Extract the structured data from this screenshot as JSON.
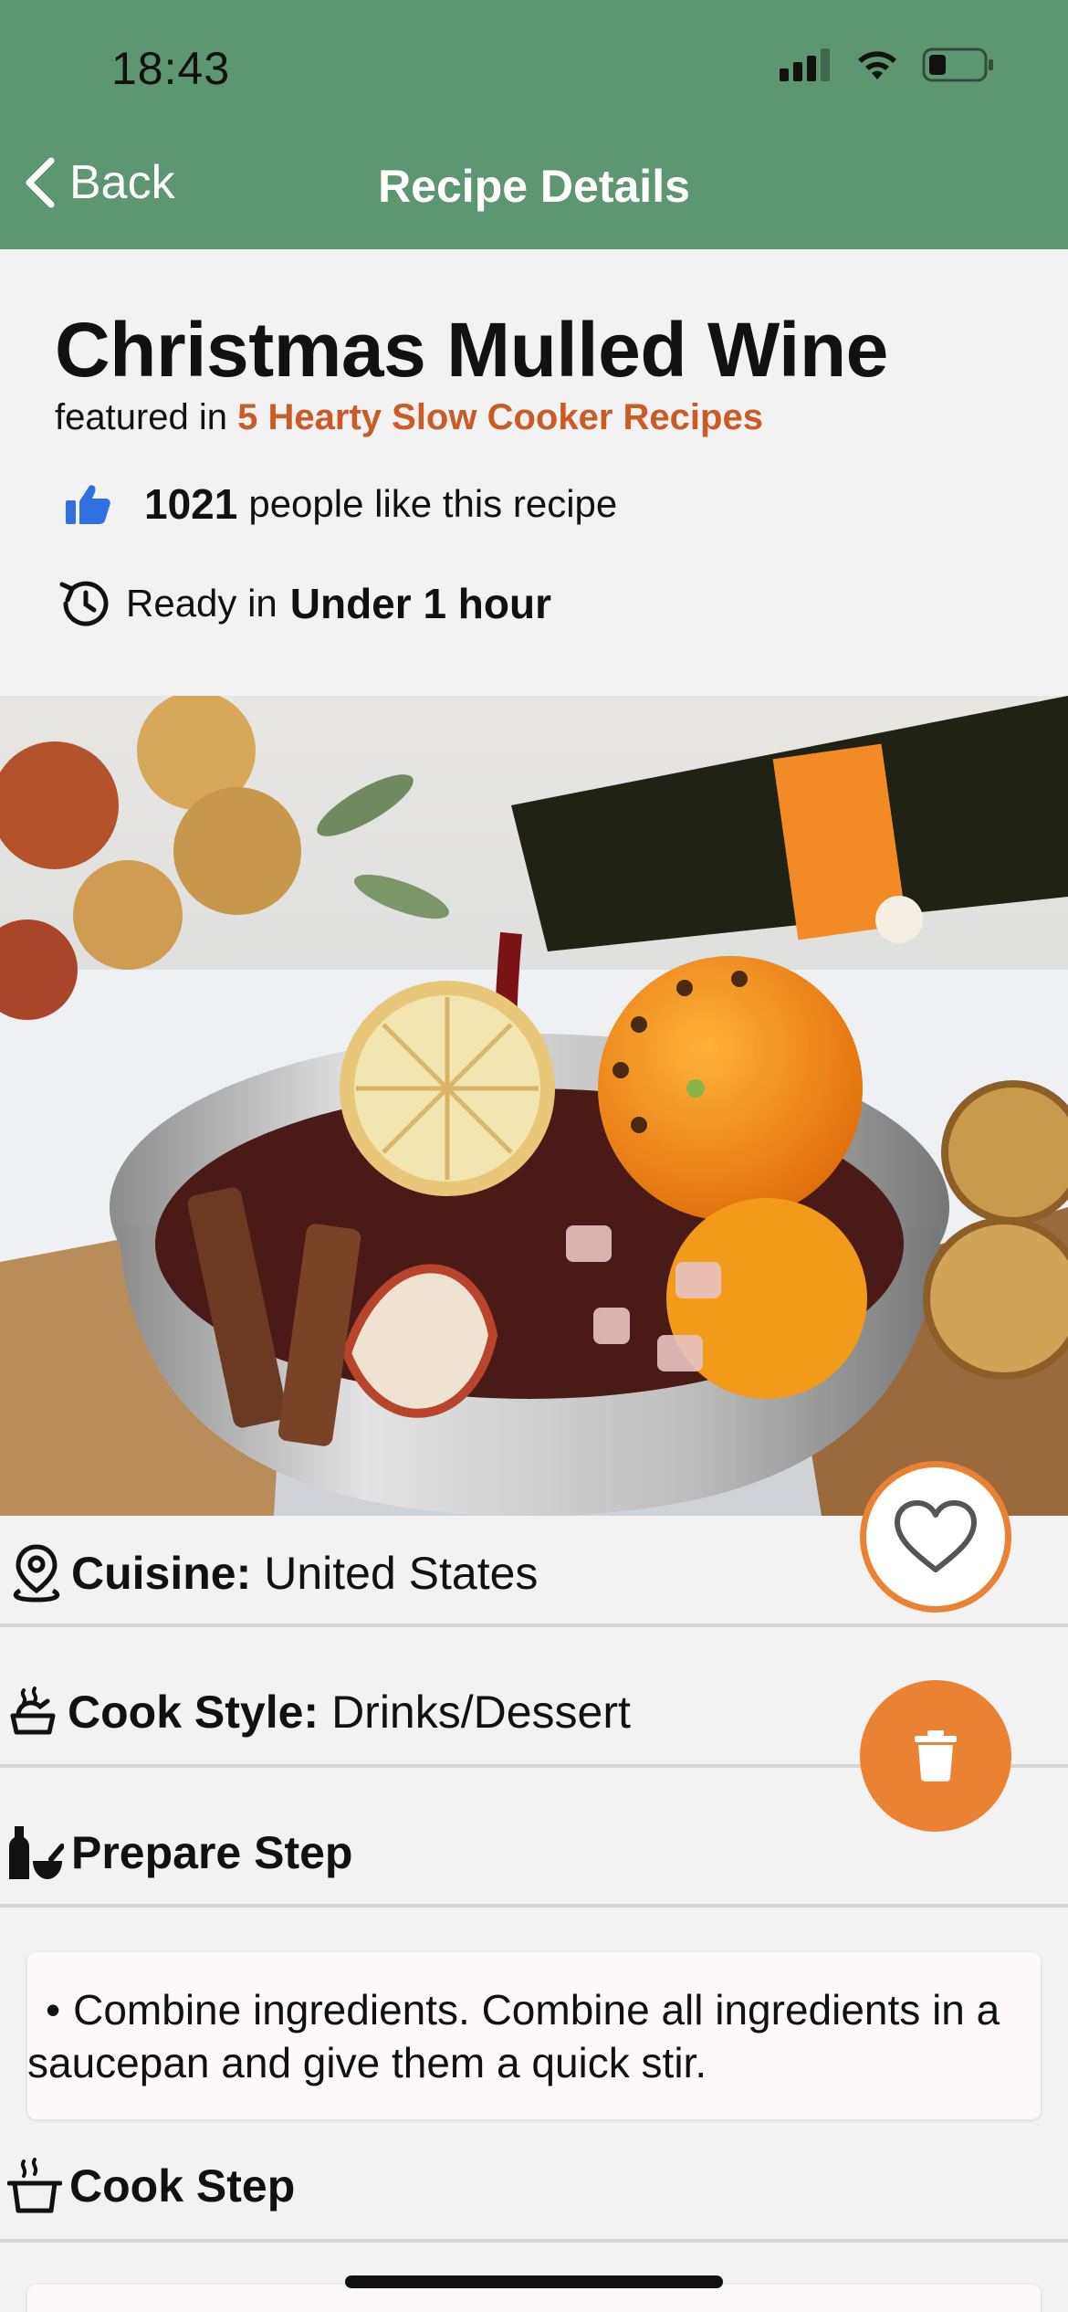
{
  "status_bar": {
    "time": "18:43"
  },
  "nav": {
    "back_label": "Back",
    "title": "Recipe Details"
  },
  "recipe": {
    "title": "Christmas Mulled Wine",
    "featured_prefix": "featured in",
    "featured_collection": "5 Hearty Slow Cooker Recipes",
    "likes_count": "1021",
    "likes_suffix": "people like this recipe",
    "ready_label": "Ready in",
    "ready_value": "Under 1 hour"
  },
  "details": {
    "cuisine_label": "Cuisine:",
    "cuisine_value": "United States",
    "cook_style_label": "Cook Style:",
    "cook_style_value": "Drinks/Dessert"
  },
  "sections": {
    "prepare_title": "Prepare Step",
    "prepare_step_1": "Combine ingredients. Combine all ingredients in a saucepan and give them a quick stir.",
    "cook_title": "Cook Step"
  },
  "colors": {
    "header": "#5d9670",
    "accent": "#e98233",
    "link": "#cc5a25",
    "like": "#2f6fe0"
  },
  "icons": [
    "chevron-left-icon",
    "signal-icon",
    "wifi-icon",
    "battery-icon",
    "thumbs-up-icon",
    "history-icon",
    "location-pin-icon",
    "cooking-pot-icon",
    "bottle-mortar-icon",
    "steaming-pot-icon",
    "heart-icon",
    "trash-icon"
  ]
}
